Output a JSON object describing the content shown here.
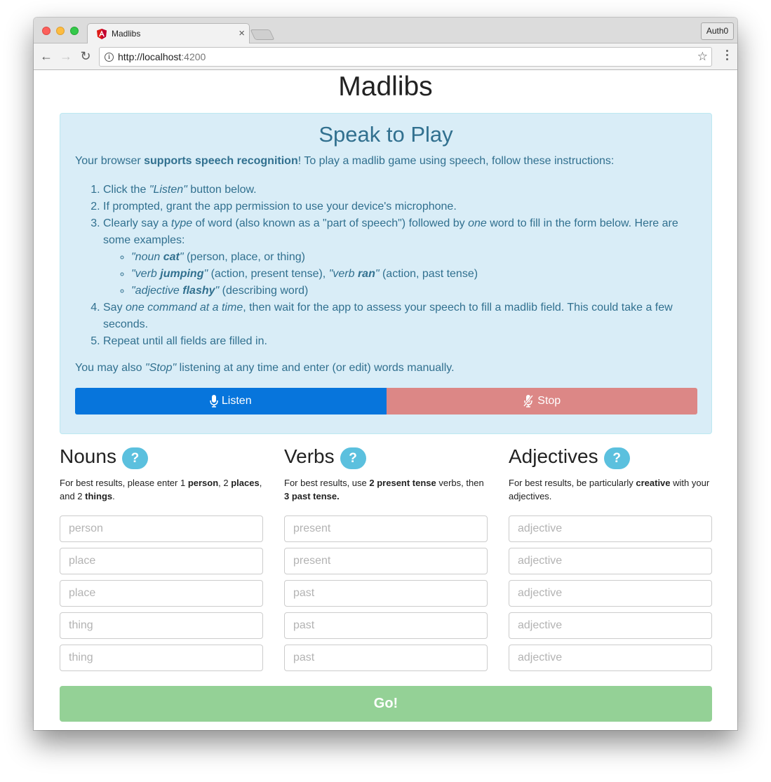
{
  "browser": {
    "tab_title": "Madlibs",
    "url_host": "http://localhost",
    "url_port": ":4200",
    "profile_label": "Auth0",
    "icons": {
      "back": "arrow-left-icon",
      "forward": "arrow-right-icon",
      "reload": "reload-icon",
      "info": "info-icon",
      "bookmark": "star-icon",
      "menu": "kebab-menu-icon",
      "close_tab": "close-icon",
      "favicon": "angular-logo-icon"
    },
    "glyphs": {
      "back": "←",
      "forward": "→",
      "reload": "↻",
      "info": "i",
      "star": "☆",
      "close": "×"
    }
  },
  "page": {
    "title": "Madlibs"
  },
  "speak": {
    "title": "Speak to Play",
    "intro_pre": "Your browser ",
    "intro_bold": "supports speech recognition",
    "intro_post": "! To play a madlib game using speech, follow these instructions:",
    "steps": [
      {
        "pre": "Click the ",
        "em": "\"Listen\"",
        "post": " button below."
      },
      {
        "text": "If prompted, grant the app permission to use your device's microphone."
      },
      {
        "pre": "Clearly say a ",
        "em": "type",
        "mid": " of word (also known as a \"part of speech\") followed by ",
        "em2": "one",
        "post": " word to fill in the form below. Here are some examples:"
      },
      {
        "pre": "Say ",
        "em": "one command at a time",
        "post": ", then wait for the app to assess your speech to fill a madlib field. This could take a few seconds."
      },
      {
        "text": "Repeat until all fields are filled in."
      }
    ],
    "examples": [
      {
        "q1": "\"noun ",
        "bold": "cat",
        "q2": "\"",
        "post": " (person, place, or thing)"
      },
      {
        "q1": "\"verb ",
        "bold": "jumping",
        "q2": "\"",
        "post": " (action, present tense), ",
        "q3": "\"verb ",
        "bold2": "ran",
        "q4": "\"",
        "post2": " (action, past tense)"
      },
      {
        "q1": "\"adjective ",
        "bold": "flashy",
        "q2": "\"",
        "post": " (describing word)"
      }
    ],
    "outro_pre": "You may also ",
    "outro_em": "\"Stop\"",
    "outro_post": " listening at any time and enter (or edit) words manually.",
    "listen_label": "Listen",
    "stop_label": "Stop",
    "colors": {
      "listen": "#0775dc",
      "stop": "#dc8786",
      "panel_bg": "#d9edf7",
      "panel_text": "#31708f"
    }
  },
  "columns": [
    {
      "title": "Nouns",
      "hint_parts": [
        {
          "t": "For best results, please enter 1 "
        },
        {
          "t": "person",
          "b": true
        },
        {
          "t": ", 2 "
        },
        {
          "t": "places",
          "b": true
        },
        {
          "t": ", and 2 "
        },
        {
          "t": "things",
          "b": true
        },
        {
          "t": "."
        }
      ],
      "fields": [
        {
          "placeholder": "person",
          "value": ""
        },
        {
          "placeholder": "place",
          "value": ""
        },
        {
          "placeholder": "place",
          "value": ""
        },
        {
          "placeholder": "thing",
          "value": ""
        },
        {
          "placeholder": "thing",
          "value": ""
        }
      ]
    },
    {
      "title": "Verbs",
      "hint_parts": [
        {
          "t": "For best results, use "
        },
        {
          "t": "2 present tense",
          "b": true
        },
        {
          "t": " verbs, then "
        },
        {
          "t": "3 past tense.",
          "b": true
        }
      ],
      "fields": [
        {
          "placeholder": "present",
          "value": ""
        },
        {
          "placeholder": "present",
          "value": ""
        },
        {
          "placeholder": "past",
          "value": ""
        },
        {
          "placeholder": "past",
          "value": ""
        },
        {
          "placeholder": "past",
          "value": ""
        }
      ]
    },
    {
      "title": "Adjectives",
      "hint_parts": [
        {
          "t": "For best results, be particularly "
        },
        {
          "t": "creative",
          "b": true
        },
        {
          "t": " with your adjectives."
        }
      ],
      "fields": [
        {
          "placeholder": "adjective",
          "value": ""
        },
        {
          "placeholder": "adjective",
          "value": ""
        },
        {
          "placeholder": "adjective",
          "value": ""
        },
        {
          "placeholder": "adjective",
          "value": ""
        },
        {
          "placeholder": "adjective",
          "value": ""
        }
      ]
    }
  ],
  "help_glyph": "?",
  "go_label": "Go!",
  "go_color": "#94d196"
}
